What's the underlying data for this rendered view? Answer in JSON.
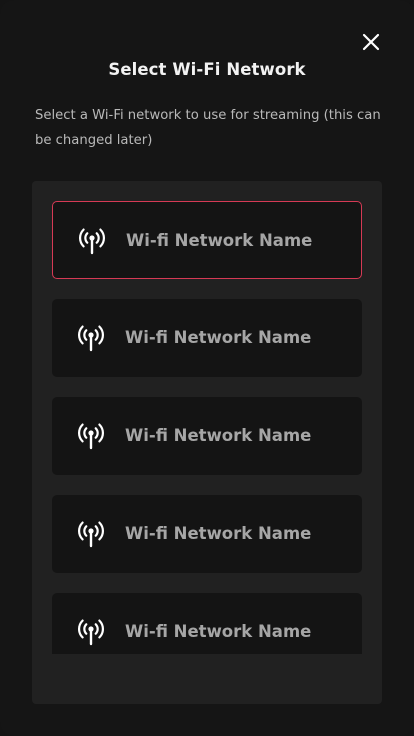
{
  "dialog": {
    "title": "Select Wi-Fi Network",
    "description": "Select a Wi-Fi network to use for streaming (this can be changed later)",
    "close_icon": "close-icon"
  },
  "networks": [
    {
      "name": "Wi-fi Network Name",
      "selected": true,
      "icon": "wifi-antenna-icon"
    },
    {
      "name": "Wi-fi Network Name",
      "selected": false,
      "icon": "wifi-antenna-icon"
    },
    {
      "name": "Wi-fi Network Name",
      "selected": false,
      "icon": "wifi-antenna-icon"
    },
    {
      "name": "Wi-fi Network Name",
      "selected": false,
      "icon": "wifi-antenna-icon"
    },
    {
      "name": "Wi-fi Network Name",
      "selected": false,
      "icon": "wifi-antenna-icon"
    }
  ],
  "colors": {
    "background": "#151515",
    "panel": "#212121",
    "card": "#141414",
    "selected_border": "#d63a55",
    "text_primary": "#f2f2f2",
    "text_secondary": "#b9b9b9",
    "text_muted": "#a6a6a6"
  }
}
